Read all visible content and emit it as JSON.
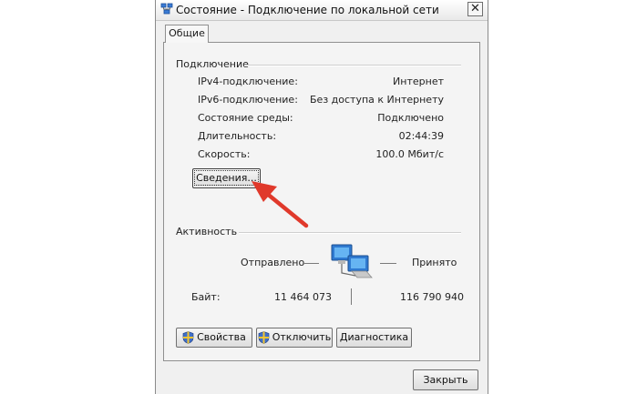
{
  "window": {
    "title": "Состояние - Подключение по локальной сети",
    "close_glyph": "✕"
  },
  "tabs": [
    {
      "label": "Общие"
    }
  ],
  "connection": {
    "heading": "Подключение",
    "rows": [
      {
        "label": "IPv4-подключение:",
        "value": "Интернет"
      },
      {
        "label": "IPv6-подключение:",
        "value": "Без доступа к Интернету"
      },
      {
        "label": "Состояние среды:",
        "value": "Подключено"
      },
      {
        "label": "Длительность:",
        "value": "02:44:39"
      },
      {
        "label": "Скорость:",
        "value": "100.0 Мбит/с"
      }
    ],
    "details_button": "Сведения..."
  },
  "activity": {
    "heading": "Активность",
    "sent_label": "Отправлено",
    "received_label": "Принято",
    "bytes_label": "Байт:",
    "bytes_sent": "11 464 073",
    "bytes_received": "116 790 940"
  },
  "buttons": {
    "properties": "Свойства",
    "disable": "Отключить",
    "diagnose": "Диагностика",
    "close": "Закрыть"
  },
  "icons": {
    "title": "network-icon",
    "activity": "computers-network-icon",
    "shield": "uac-shield-icon",
    "annotation": "red-arrow"
  },
  "colors": {
    "annotation_arrow": "#e0392b"
  }
}
